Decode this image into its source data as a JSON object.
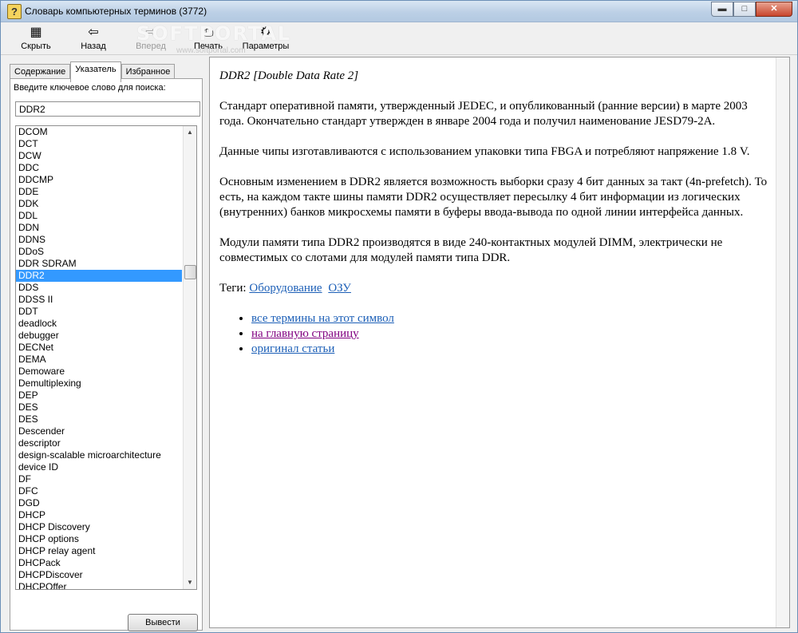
{
  "window": {
    "title": "Словарь компьютерных терминов (3772)",
    "icon": "help-book-icon"
  },
  "toolbar": {
    "hide": "Скрыть",
    "back": "Назад",
    "forward": "Вперед",
    "print": "Печать",
    "options": "Параметры"
  },
  "watermark": {
    "logo": "SOFTPORTAL",
    "url": "www.softportal.com"
  },
  "tabs": [
    {
      "label": "Содержание",
      "active": false
    },
    {
      "label": "Указатель",
      "active": true
    },
    {
      "label": "Избранное",
      "active": false
    }
  ],
  "index": {
    "hint": "Введите ключевое слово для поиска:",
    "search_value": "DDR2",
    "items": [
      "DCOM",
      "DCT",
      "DCW",
      "DDC",
      "DDCMP",
      "DDE",
      "DDK",
      "DDL",
      "DDN",
      "DDNS",
      "DDoS",
      "DDR SDRAM",
      "DDR2",
      "DDS",
      "DDSS II",
      "DDT",
      "deadlock",
      "debugger",
      "DECNet",
      "DEMA",
      "Demoware",
      "Demultiplexing",
      "DEP",
      "DES",
      "DES",
      "Descender",
      "descriptor",
      "design-scalable microarchitecture",
      "device ID",
      "DF",
      "DFC",
      "DGD",
      "DHCP",
      "DHCP Discovery",
      "DHCP options",
      "DHCP relay agent",
      "DHCPack",
      "DHCPDiscover",
      "DHCPOffer"
    ],
    "selected": "DDR2",
    "show_button": "Вывести"
  },
  "article": {
    "heading": "DDR2 [Double Data Rate 2]",
    "paragraphs": [
      "Стандарт оперативной памяти, утвержденный JEDEC, и опубликованный (ранние версии) в марте 2003 года. Окончательно стандарт утвержден в январе 2004 года и получил наименование JESD79-2A.",
      "Данные чипы изготавливаются с использованием упаковки типа FBGA и потребляют напряжение 1.8 V.",
      "Основным изменением в DDR2 является возможность выборки сразу 4 бит данных за такт (4n-prefetch). То есть, на каждом такте шины памяти DDR2 осуществляет пересылку 4 бит информации из логических (внутренних) банков микросхемы памяти в буферы ввода-вывода по одной линии интерфейса данных.",
      "Модули памяти типа DDR2 производятся в виде 240-контактных модулей DIMM, электрически не совместимых со слотами для модулей памяти типа DDR."
    ],
    "tags_label": "Теги:",
    "tags": [
      "Оборудование",
      "ОЗУ"
    ],
    "links": [
      "все термины на этот символ",
      "на главную страницу",
      "оригинал статьи"
    ]
  }
}
